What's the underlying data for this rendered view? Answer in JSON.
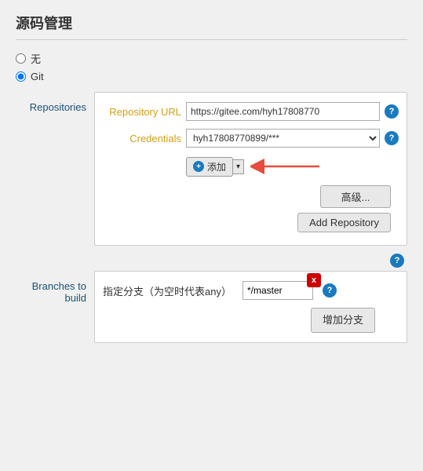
{
  "page": {
    "title": "源码管理"
  },
  "radio_group": {
    "options": [
      {
        "id": "opt-none",
        "label": "无",
        "checked": false
      },
      {
        "id": "opt-git",
        "label": "Git",
        "checked": true
      }
    ]
  },
  "repositories_section": {
    "label": "Repositories",
    "form": {
      "repo_url_label": "Repository URL",
      "repo_url_value": "https://gitee.com/hyh17808770",
      "repo_url_placeholder": "https://gitee.com/hyh17808770",
      "credentials_label": "Credentials",
      "credentials_value": "hyh17808770899/***",
      "add_btn_label": "添加",
      "advanced_btn_label": "高级...",
      "add_repository_btn_label": "Add Repository"
    }
  },
  "floating_help": "?",
  "branches_section": {
    "label": "Branches to build",
    "form": {
      "branch_label": "指定分支（为空时代表any）",
      "branch_value": "*/master",
      "delete_btn_label": "x",
      "add_branch_btn_label": "增加分支"
    }
  },
  "help_icon": "?",
  "icons": {
    "add_circle": "+",
    "dropdown_arrow": "▾",
    "radio_unchecked": "○",
    "radio_checked": "●"
  }
}
